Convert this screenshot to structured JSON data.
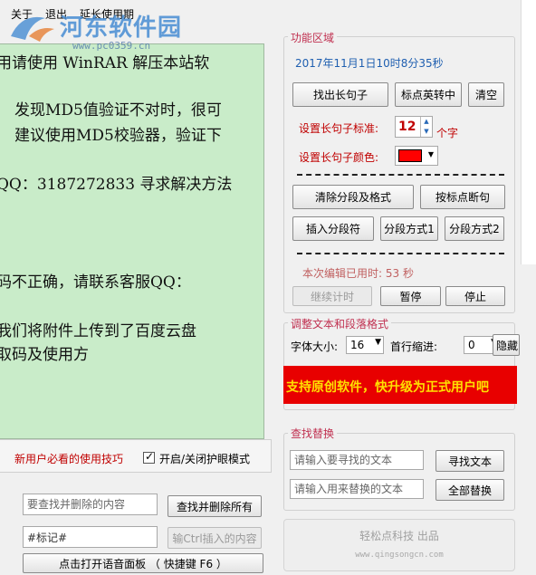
{
  "menu": {
    "items": [
      "关于",
      "退出",
      "延长使用期"
    ]
  },
  "watermark": {
    "site": "河东软件园",
    "url": "www.pc0359.cn"
  },
  "editor": {
    "lines": [
      "用请使用 WinRAR 解压本站软",
      "发现MD5值验证不对时，很可",
      "建议使用MD5校验器，验证下",
      "QQ：3187272833 寻求解决方法",
      "码不正确，请联系客服QQ：",
      "我们将附件上传到了百度云盘",
      "取码及使用方"
    ]
  },
  "bottom_left": {
    "tips_link": "新用户必看的使用技巧",
    "eye_mode_label": "开启/关闭护眼模式",
    "eye_mode_checked": true
  },
  "function_area": {
    "title": "功能区域",
    "datetime": "2017年11月1日10时8分35秒",
    "find_long_sentence": "找出长句子",
    "punct_to_english": "标点英转中",
    "clear": "清空",
    "long_sentence_standard_label": "设置长句子标准:",
    "long_sentence_standard_value": "12",
    "unit_chars": "个字",
    "long_sentence_color_label": "设置长句子颜色:",
    "long_sentence_color": "#ff0000",
    "remove_paragraph_format": "清除分段及格式",
    "break_by_punct": "按标点断句",
    "insert_separator": "插入分段符",
    "split_mode_1": "分段方式1",
    "split_mode_2": "分段方式2",
    "edit_time": "本次编辑已用时: 53 秒",
    "continue_timer": "继续计时",
    "pause": "暂停",
    "stop": "停止"
  },
  "adjust_format": {
    "title": "调整文本和段落格式",
    "font_size_label": "字体大小:",
    "font_size_value": "16",
    "indent_label": "首行缩进:",
    "indent_value": "0",
    "hide_button": "隐藏"
  },
  "banner": {
    "text": "支持原创软件，快升级为正式用户吧",
    "color": "#e80000"
  },
  "find_replace": {
    "title": "查找替换",
    "find_placeholder": "请输入要寻找的文本",
    "find_button": "寻找文本",
    "replace_placeholder": "请输入用来替换的文本",
    "replace_all_button": "全部替换"
  },
  "bottom_tools": {
    "delete_placeholder": "要查找并删除的内容",
    "delete_all_button": "查找并删除所有",
    "tag_value": "#标记#",
    "ctrl_insert_button": "输Ctrl插入的内容",
    "voice_panel_button": "点击打开语音面板 （ 快捷键 F6 ）"
  },
  "footer": {
    "brand": "轻松点科技 出品",
    "url": "www.qingsongcn.com"
  }
}
